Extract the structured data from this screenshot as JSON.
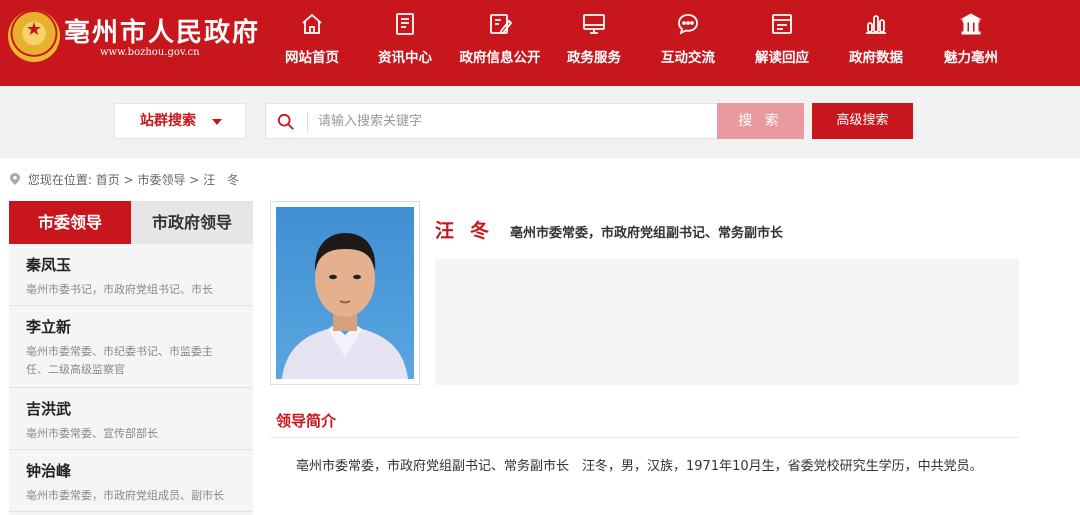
{
  "header": {
    "site_title": "亳州市人民政府",
    "site_url": "www.bozhou.gov.cn",
    "brand_color": "#c8161d",
    "nav": [
      {
        "label": "网站首页",
        "icon": "home-icon"
      },
      {
        "label": "资讯中心",
        "icon": "document-icon"
      },
      {
        "label": "政府信息公开",
        "icon": "edit-icon"
      },
      {
        "label": "政务服务",
        "icon": "monitor-icon"
      },
      {
        "label": "互动交流",
        "icon": "chat-icon"
      },
      {
        "label": "解读回应",
        "icon": "window-icon"
      },
      {
        "label": "政府数据",
        "icon": "bar-chart-icon"
      },
      {
        "label": "魅力亳州",
        "icon": "landmark-icon"
      }
    ]
  },
  "search": {
    "site_select": "站群搜索",
    "placeholder": "请输入搜索关键字",
    "search_button": "搜 索",
    "advanced_button": "高级搜索"
  },
  "breadcrumb": {
    "prefix": "您现在位置:",
    "items": [
      "首页",
      "市委领导",
      "汪　冬"
    ],
    "separator": ">"
  },
  "sidebar": {
    "tabs": [
      "市委领导",
      "市政府领导"
    ],
    "leaders": [
      {
        "name": "秦凤玉",
        "title": "亳州市委书记，市政府党组书记、市长"
      },
      {
        "name": "李立新",
        "title": "亳州市委常委、市纪委书记、市监委主任、二级高级监察官"
      },
      {
        "name": "吉洪武",
        "title": "亳州市委常委、宣传部部长"
      },
      {
        "name": "钟治峰",
        "title": "亳州市委常委，市政府党组成员、副市长"
      }
    ]
  },
  "profile": {
    "name": "汪冬",
    "title": "亳州市委常委，市政府党组副书记、常务副市长",
    "intro_heading": "领导简介",
    "intro_text": "亳州市委常委，市政府党组副书记、常务副市长　汪冬，男，汉族，1971年10月生，省委党校研究生学历，中共党员。"
  }
}
